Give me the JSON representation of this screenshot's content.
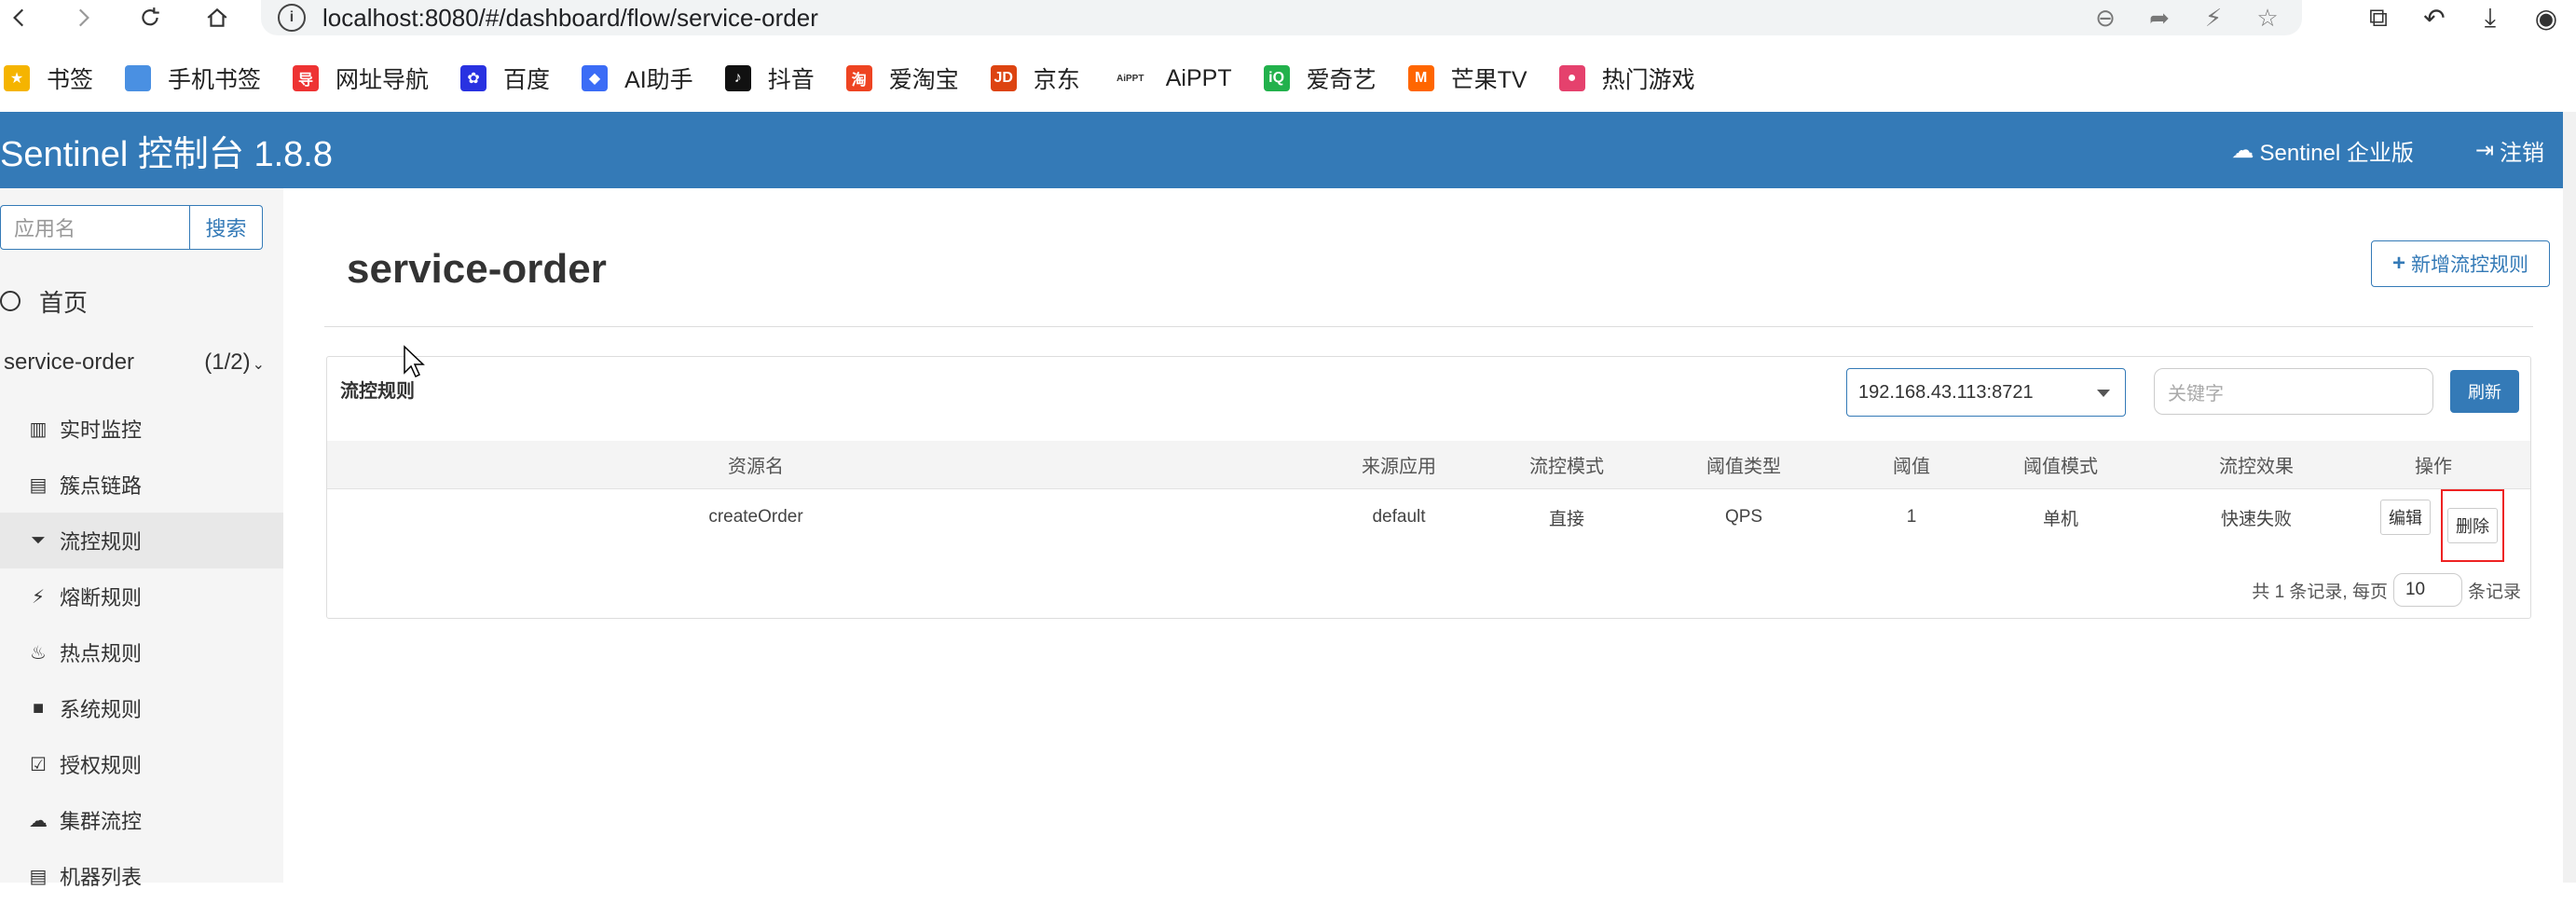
{
  "browser": {
    "url": "localhost:8080/#/dashboard/flow/service-order",
    "info_icon": "i"
  },
  "bookmarks": [
    {
      "label": "书签",
      "icon": "star-icon",
      "color": "#f5b400",
      "glyph": "★"
    },
    {
      "label": "手机书签",
      "icon": "phone-icon",
      "color": "#4a90e2",
      "glyph": ""
    },
    {
      "label": "网址导航",
      "icon": "nav-icon",
      "color": "#e33",
      "glyph": "导"
    },
    {
      "label": "百度",
      "icon": "baidu-icon",
      "color": "#2932e1",
      "glyph": "✿"
    },
    {
      "label": "AI助手",
      "icon": "ai-icon",
      "color": "#3b6cf6",
      "glyph": "◆"
    },
    {
      "label": "抖音",
      "icon": "douyin-icon",
      "color": "#111",
      "glyph": "♪"
    },
    {
      "label": "爱淘宝",
      "icon": "taobao-icon",
      "color": "#e42",
      "glyph": "淘"
    },
    {
      "label": "京东",
      "icon": "jd-icon",
      "color": "#d41",
      "glyph": "JD"
    },
    {
      "label": "AiPPT",
      "icon": "aippt-icon",
      "color": "#fff",
      "glyph": "AiPPT"
    },
    {
      "label": "爱奇艺",
      "icon": "iqiyi-icon",
      "color": "#22b14c",
      "glyph": "iQ"
    },
    {
      "label": "芒果TV",
      "icon": "mango-icon",
      "color": "#f60",
      "glyph": "M"
    },
    {
      "label": "热门游戏",
      "icon": "game-icon",
      "color": "#e5416d",
      "glyph": "●"
    }
  ],
  "header": {
    "title": "Sentinel 控制台 1.8.8",
    "enterprise": "Sentinel 企业版",
    "logout": "注销"
  },
  "sidebar": {
    "search_placeholder": "应用名",
    "search_button": "搜索",
    "home": "首页",
    "app_name": "service-order",
    "app_count": "(1/2)",
    "items": [
      {
        "label": "实时监控",
        "icon": "bar-chart-icon"
      },
      {
        "label": "簇点链路",
        "icon": "list-icon"
      },
      {
        "label": "流控规则",
        "icon": "filter-icon"
      },
      {
        "label": "熔断规则",
        "icon": "flash-icon"
      },
      {
        "label": "热点规则",
        "icon": "fire-icon"
      },
      {
        "label": "系统规则",
        "icon": "lock-icon"
      },
      {
        "label": "授权规则",
        "icon": "check-icon"
      },
      {
        "label": "集群流控",
        "icon": "cloud-icon"
      },
      {
        "label": "机器列表",
        "icon": "list-icon"
      }
    ]
  },
  "main": {
    "title": "service-order",
    "add_button": "新增流控规则",
    "panel_title": "流控规则",
    "machine": "192.168.43.113:8721",
    "keyword_placeholder": "关键字",
    "refresh": "刷新",
    "columns": [
      "资源名",
      "来源应用",
      "流控模式",
      "阈值类型",
      "阈值",
      "阈值模式",
      "流控效果",
      "操作"
    ],
    "rows": [
      [
        "createOrder",
        "default",
        "直接",
        "QPS",
        "1",
        "单机",
        "快速失败"
      ]
    ],
    "edit": "编辑",
    "delete": "删除",
    "pager_prefix": "共 1 条记录, 每页",
    "page_size": "10",
    "pager_suffix": "条记录"
  },
  "colors": {
    "primary": "#347ab7",
    "highlight": "#e22222"
  }
}
